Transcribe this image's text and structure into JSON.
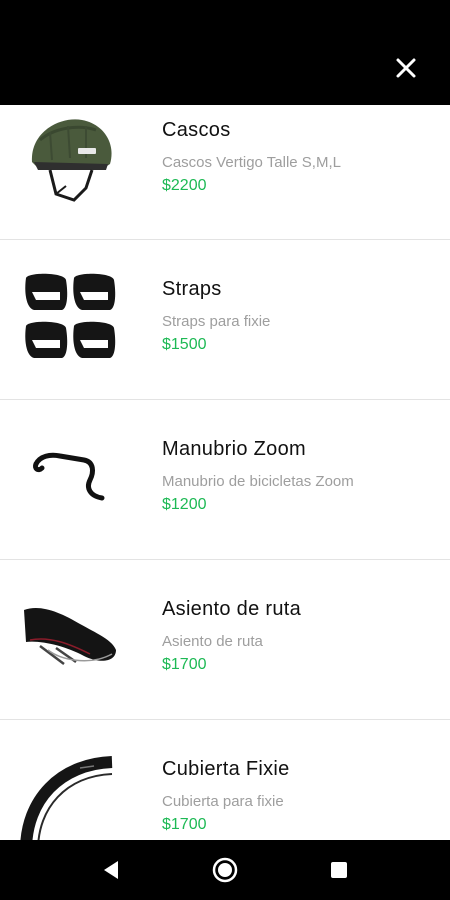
{
  "header": {
    "close_icon": "close-icon"
  },
  "products": [
    {
      "name": "Cascos",
      "description": "Cascos Vertigo Talle S,M,L",
      "price": "$2200",
      "image": "helmet-image"
    },
    {
      "name": "Straps",
      "description": "Straps para fixie",
      "price": "$1500",
      "image": "straps-image"
    },
    {
      "name": "Manubrio Zoom",
      "description": "Manubrio de bicicletas Zoom",
      "price": "$1200",
      "image": "handlebar-image"
    },
    {
      "name": "Asiento de ruta",
      "description": "Asiento de ruta",
      "price": "$1700",
      "image": "saddle-image"
    },
    {
      "name": "Cubierta Fixie",
      "description": "Cubierta para fixie",
      "price": "$1700",
      "image": "tire-image"
    }
  ],
  "colors": {
    "price": "#1db954",
    "bars": "#000000"
  },
  "navigation": {
    "back_icon": "back-triangle-icon",
    "home_icon": "home-circle-icon",
    "recents_icon": "recents-square-icon"
  }
}
